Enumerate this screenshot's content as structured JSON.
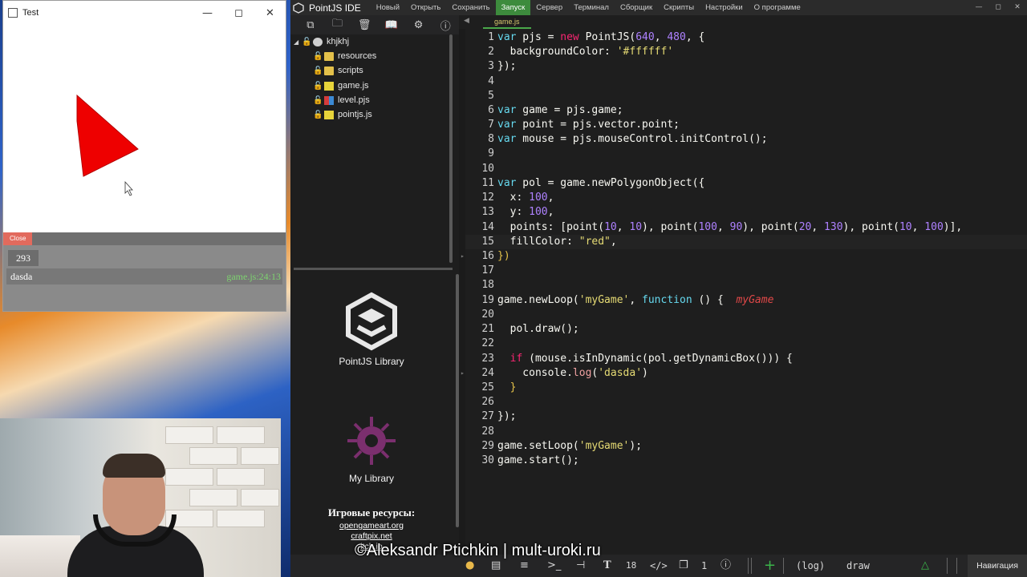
{
  "test_window": {
    "title": "Test",
    "close_tab": "Close",
    "counter": "293",
    "log_text": "dasda",
    "log_source": "game.js:24:13",
    "polygon_color": "#ee0000"
  },
  "ide": {
    "app_title": "PointJS IDE",
    "menu": [
      "Новый",
      "Открыть",
      "Сохранить",
      "Запуск",
      "Сервер",
      "Терминал",
      "Сборщик",
      "Скрипты",
      "Настройки",
      "О программе"
    ],
    "active_menu": "Запуск",
    "tab": "game.js",
    "tree": {
      "root": "khjkhj",
      "items": [
        {
          "label": "resources",
          "type": "folder"
        },
        {
          "label": "scripts",
          "type": "folder"
        },
        {
          "label": "game.js",
          "type": "js"
        },
        {
          "label": "level.pjs",
          "type": "pjs"
        },
        {
          "label": "pointjs.js",
          "type": "js"
        }
      ]
    },
    "libraries": [
      {
        "label": "PointJS Library"
      },
      {
        "label": "My Library"
      }
    ],
    "resources": {
      "title": "Игровые ресурсы:",
      "links": [
        "opengameart.org",
        "craftpix.net",
        "itch.io"
      ]
    },
    "code_lines": [
      "1",
      "2",
      "3",
      "4",
      "5",
      "6",
      "7",
      "8",
      "9",
      "10",
      "11",
      "12",
      "13",
      "14",
      "15",
      "16",
      "17",
      "18",
      "19",
      "20",
      "21",
      "22",
      "23",
      "24",
      "25",
      "26",
      "27",
      "28",
      "29",
      "30"
    ],
    "code": {
      "l1_a": "var",
      "l1_b": " pjs = ",
      "l1_c": "new",
      "l1_d": " PointJS(",
      "l1_e": "640",
      "l1_f": ", ",
      "l1_g": "480",
      "l1_h": ", {",
      "l2_a": "  backgroundColor: ",
      "l2_b": "'#ffffff'",
      "l3": "});",
      "l6_a": "var",
      "l6_b": " game = pjs.game;",
      "l7_a": "var",
      "l7_b": " point = pjs.vector.point;",
      "l8_a": "var",
      "l8_b": " mouse = pjs.mouseControl.initControl();",
      "l11_a": "var",
      "l11_b": " pol = game.newPolygonObject({",
      "l12_a": "  x: ",
      "l12_b": "100",
      "l12_c": ",",
      "l13_a": "  y: ",
      "l13_b": "100",
      "l13_c": ",",
      "l14_a": "  points: [point(",
      "l14_b": "10",
      "l14_c": ", ",
      "l14_d": "10",
      "l14_e": "), point(",
      "l14_f": "100",
      "l14_g": ", ",
      "l14_h": "90",
      "l14_i": "), point(",
      "l14_j": "20",
      "l14_k": ", ",
      "l14_l": "130",
      "l14_m": "), point(",
      "l14_n": "10",
      "l14_o": ", ",
      "l14_p": "100",
      "l14_q": ")],",
      "l15_a": "  fillColor: ",
      "l15_b": "\"red\"",
      "l15_c": ",",
      "l16": "})",
      "l19_a": "game.newLoop(",
      "l19_b": "'myGame'",
      "l19_c": ", ",
      "l19_d": "function",
      "l19_e": " () {  ",
      "l19_f": "myGame",
      "l21": "  pol.draw();",
      "l23_a": "  ",
      "l23_b": "if",
      "l23_c": " (mouse.isInDynamic(pol.getDynamicBox())) {",
      "l24_a": "    console.",
      "l24_b": "log",
      "l24_c": "(",
      "l24_d": "'dasda'",
      "l24_e": ")",
      "l25": "  }",
      "l27": "});",
      "l29_a": "game.setLoop(",
      "l29_b": "'myGame'",
      "l29_c": ");",
      "l30": "game.start();"
    },
    "statusbar": {
      "font_size": "18",
      "count": "1",
      "log": "(log)",
      "draw": "draw",
      "nav": "Навигация"
    }
  },
  "watermark": "©Aleksandr Ptichkin | mult-uroki.ru",
  "colors": {
    "active_menu": "#3d8b3d",
    "keyword": "#66d9ef",
    "string": "#e6db74",
    "number": "#ae81ff"
  }
}
